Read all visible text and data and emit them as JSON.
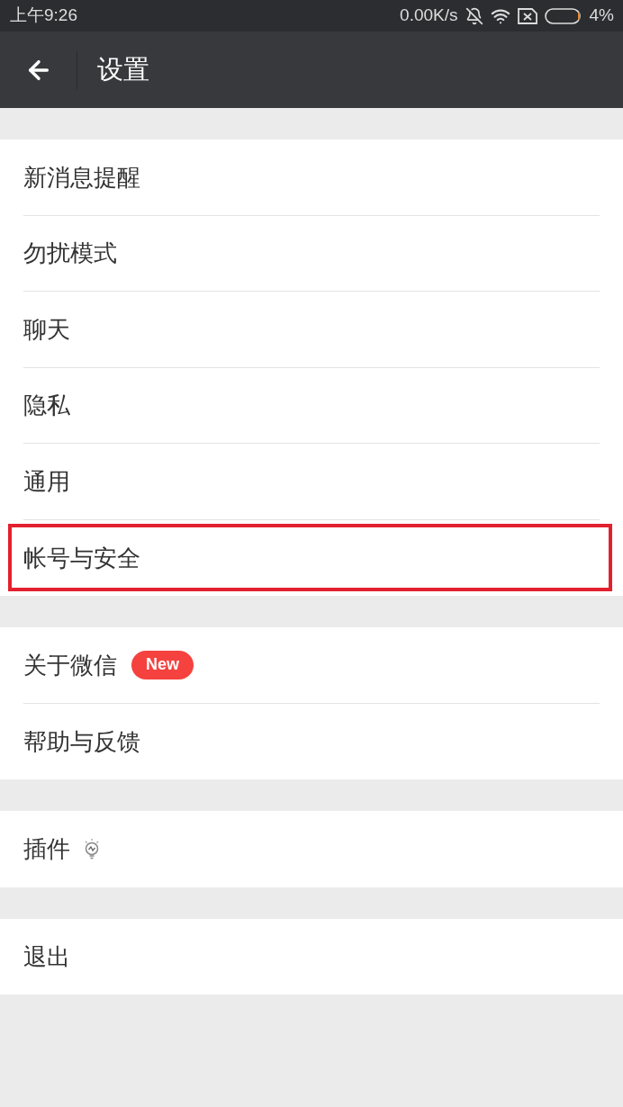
{
  "status_bar": {
    "time": "上午9:26",
    "net_speed": "0.00K/s",
    "battery": "4%"
  },
  "header": {
    "title": "设置"
  },
  "groups": [
    {
      "items": [
        {
          "label": "新消息提醒",
          "kind": "plain",
          "highlighted": false
        },
        {
          "label": "勿扰模式",
          "kind": "plain",
          "highlighted": false
        },
        {
          "label": "聊天",
          "kind": "plain",
          "highlighted": false
        },
        {
          "label": "隐私",
          "kind": "plain",
          "highlighted": false
        },
        {
          "label": "通用",
          "kind": "plain",
          "highlighted": false
        },
        {
          "label": "帐号与安全",
          "kind": "plain",
          "highlighted": true
        }
      ]
    },
    {
      "items": [
        {
          "label": "关于微信",
          "kind": "badge",
          "badge": "New",
          "highlighted": false
        },
        {
          "label": "帮助与反馈",
          "kind": "plain",
          "highlighted": false
        }
      ]
    },
    {
      "items": [
        {
          "label": "插件",
          "kind": "icon",
          "highlighted": false
        }
      ]
    },
    {
      "items": [
        {
          "label": "退出",
          "kind": "plain",
          "highlighted": false
        }
      ]
    }
  ]
}
